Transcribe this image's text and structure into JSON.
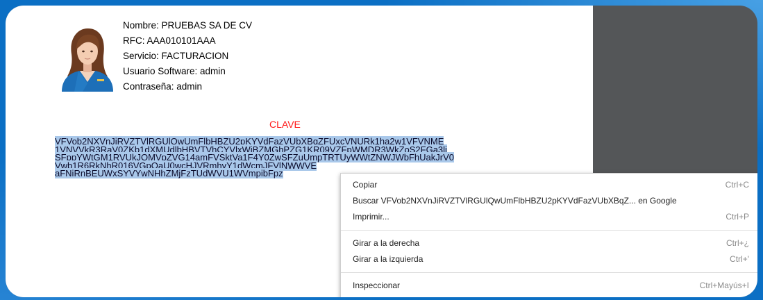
{
  "profile": {
    "nombre": "Nombre: PRUEBAS SA DE CV",
    "rfc": "RFC: AAA010101AAA",
    "servicio": "Servicio: FACTURACION",
    "usuario": "Usuario Software: admin",
    "contrasena": "Contraseña: admin"
  },
  "clave": {
    "title": "CLAVE",
    "lines": [
      "VFVob2NXVnJiRVZTVlRGUlQwUmFlbHBZU2pKYVdFazVUbXBqZFUxcVNURk1ha2w1VFVNME",
      "1VNVVkR3RaV0ZKb1dXMUdlbHBVTVhCYVlxWjBZMGhPZG1KR09VZFpWMDR3WkZoS2FGa3li",
      "SFppYWtGM1RVUkJOMVpZVG14amFVSktVa1F4Y0ZwSFZuUmpTRTUyWWtZNWJWbFhUakJrV0",
      "Vwb1R6RkNhR016VGpOaU0wcHJVRmhvY1dWcmJFVlNWWVE",
      "aFNiRnBEUWxSYVYwNHhZMjFzTUdWVU1WVmpibFpz"
    ]
  },
  "context_menu": {
    "copy": {
      "label": "Copiar",
      "shortcut": "Ctrl+C"
    },
    "search": {
      "label": "Buscar VFVob2NXVnJiRVZTVlRGUlQwUmFlbHBZU2pKYVdFazVUbXBqZ... en Google"
    },
    "print": {
      "label": "Imprimir...",
      "shortcut": "Ctrl+P"
    },
    "rotate_right": {
      "label": "Girar a la derecha",
      "shortcut": "Ctrl+¿"
    },
    "rotate_left": {
      "label": "Girar a la izquierda",
      "shortcut": "Ctrl+'"
    },
    "inspect": {
      "label": "Inspeccionar",
      "shortcut": "Ctrl+Mayús+I"
    }
  },
  "colors": {
    "frame": "#0b6fc4",
    "clave_title": "#ff1a1a",
    "selection": "#a9c8ea",
    "side_panel": "#545658"
  }
}
